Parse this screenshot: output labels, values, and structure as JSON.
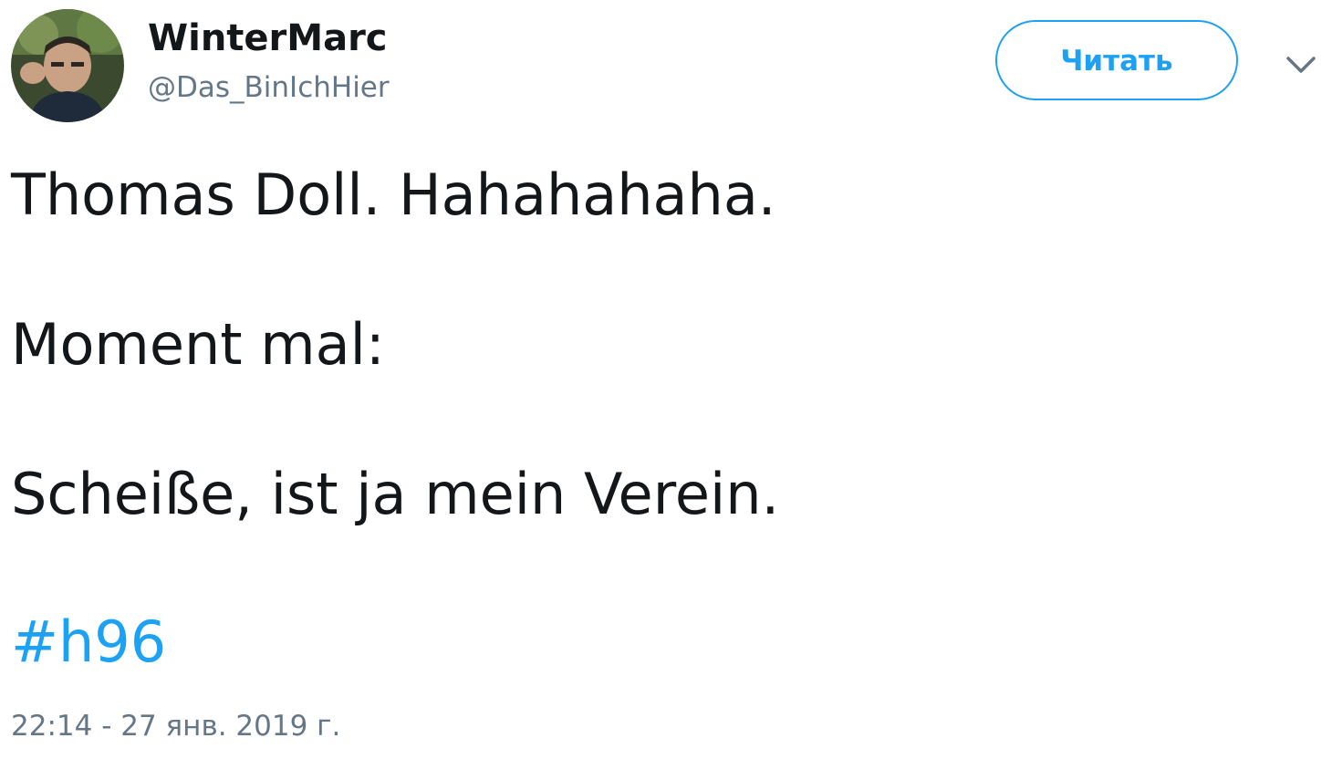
{
  "user": {
    "display_name": "WinterMarc",
    "handle": "@Das_BinIchHier"
  },
  "follow_button": {
    "label": "Читать"
  },
  "tweet": {
    "lines": [
      "Thomas Doll. Hahahahaha.",
      "Moment mal:",
      "Scheiße, ist ja mein Verein."
    ],
    "hashtag": "#h96",
    "timestamp": "22:14 - 27 янв. 2019 г."
  },
  "icons": {
    "avatar": "user-avatar-photo",
    "more": "chevron-down-icon"
  },
  "colors": {
    "accent": "#1da1f2",
    "text": "#14171a",
    "secondary": "#657786"
  }
}
